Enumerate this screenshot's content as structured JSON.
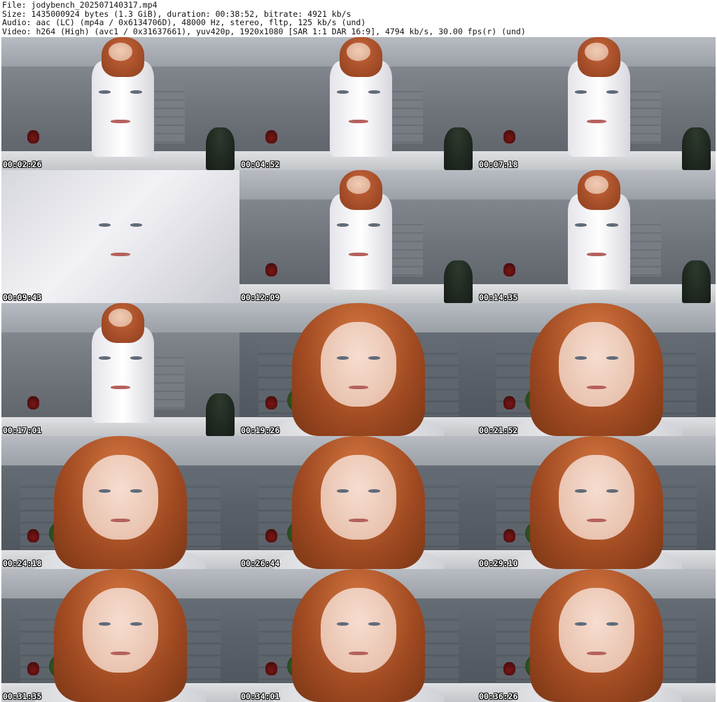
{
  "header": {
    "file_line": "File: jodybench_202507140317.mp4",
    "size_line": "Size: 1435000924 bytes (1.3 GiB), duration: 00:38:52, bitrate: 4921 kb/s",
    "audio_line": "Audio: aac (LC) (mp4a / 0x6134706D), 48000 Hz, stereo, fltp, 125 kb/s (und)",
    "video_line": "Video: h264 (High) (avc1 / 0x31637661), yuv420p, 1920x1080 [SAR 1:1 DAR 16:9], 4794 kb/s, 30.00 fps(r) (und)"
  },
  "thumbnails": [
    {
      "timestamp": "00:02:26",
      "shot": "room-back"
    },
    {
      "timestamp": "00:04:52",
      "shot": "room-front"
    },
    {
      "timestamp": "00:07:18",
      "shot": "room-front"
    },
    {
      "timestamp": "00:09:43",
      "shot": "shirt-closeup"
    },
    {
      "timestamp": "00:12:09",
      "shot": "room-front"
    },
    {
      "timestamp": "00:14:35",
      "shot": "room-back"
    },
    {
      "timestamp": "00:17:01",
      "shot": "room-back"
    },
    {
      "timestamp": "00:19:26",
      "shot": "face-closeup"
    },
    {
      "timestamp": "00:21:52",
      "shot": "face-closeup"
    },
    {
      "timestamp": "00:24:18",
      "shot": "face-closeup"
    },
    {
      "timestamp": "00:26:44",
      "shot": "face-closeup"
    },
    {
      "timestamp": "00:29:10",
      "shot": "face-closeup"
    },
    {
      "timestamp": "00:31:35",
      "shot": "face-closeup"
    },
    {
      "timestamp": "00:34:01",
      "shot": "face-closeup"
    },
    {
      "timestamp": "00:36:26",
      "shot": "face-closeup"
    }
  ]
}
